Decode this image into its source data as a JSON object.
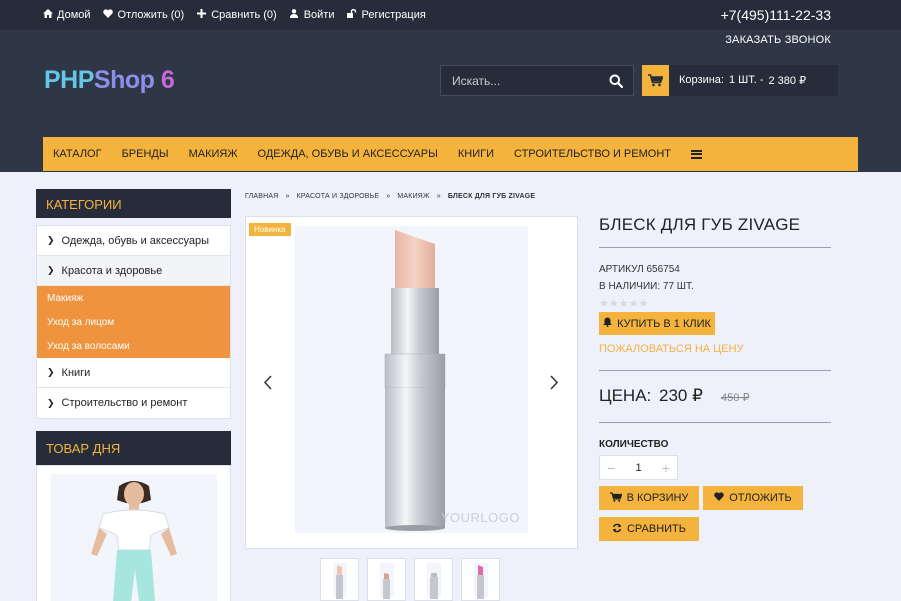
{
  "topbar": {
    "links": [
      {
        "label": "Домой",
        "icon": "home-icon"
      },
      {
        "label": "Отложить (0)",
        "icon": "heart-icon"
      },
      {
        "label": "Сравнить (0)",
        "icon": "plus-icon"
      },
      {
        "label": "Войти",
        "icon": "user-icon"
      },
      {
        "label": "Регистрация",
        "icon": "unlock-icon"
      }
    ],
    "phone": "+7(495)111-22-33",
    "callback": "ЗАКАЗАТЬ ЗВОНОК"
  },
  "logo": {
    "part1": "PHP",
    "part2": "Shop",
    "part3": " 6"
  },
  "search": {
    "placeholder": "Искать..."
  },
  "cart": {
    "label": "Корзина:",
    "count": "1 ШТ. -",
    "total": "2 380 ₽"
  },
  "nav": {
    "items": [
      "КАТАЛОГ",
      "БРЕНДЫ",
      "МАКИЯЖ",
      "ОДЕЖДА, ОБУВЬ И АКСЕССУАРЫ",
      "КНИГИ",
      "СТРОИТЕЛЬСТВО И РЕМОНТ"
    ]
  },
  "sidebar": {
    "categories_title": "КАТЕГОРИИ",
    "categories": [
      "Одежда, обувь и аксессуары",
      "Красота и здоровье",
      "Книги",
      "Строительство и ремонт"
    ],
    "subcategories": [
      "Макияж",
      "Уход за лицом",
      "Уход за волосами"
    ],
    "deal_title": "ТОВАР ДНЯ"
  },
  "breadcrumbs": {
    "items": [
      "ГЛАВНАЯ",
      "»",
      "КРАСОТА И ЗДОРОВЬЕ",
      "»",
      "МАКИЯЖ",
      "»",
      "БЛЕСК ДЛЯ ГУБ ZIVAGE"
    ]
  },
  "gallery": {
    "badge": "Новинка",
    "watermark": "YOURLOGO"
  },
  "product": {
    "title": "БЛЕСК ДЛЯ ГУБ ZIVAGE",
    "sku": "АРТИКУЛ 656754",
    "stock": "В НАЛИЧИИ: 77 ШТ.",
    "rating": 0,
    "buy_one_click": "КУПИТЬ В 1 КЛИК",
    "complain": "ПОЖАЛОВАТЬСЯ НА ЦЕНУ",
    "price_label": "ЦЕНА:",
    "price": "230 ₽",
    "old_price": "450 ₽",
    "qty_label": "КОЛИЧЕСТВО",
    "qty": "1",
    "add_to_cart": "В КОРЗИНУ",
    "wishlist": "ОТЛОЖИТЬ",
    "compare": "СРАВНИТЬ"
  },
  "colors": {
    "accent": "#f3b33d",
    "header_bg": "#2f3646",
    "topbar_bg": "#262c3a",
    "submenu": "#f0933f",
    "page_bg": "#eef1fb"
  }
}
